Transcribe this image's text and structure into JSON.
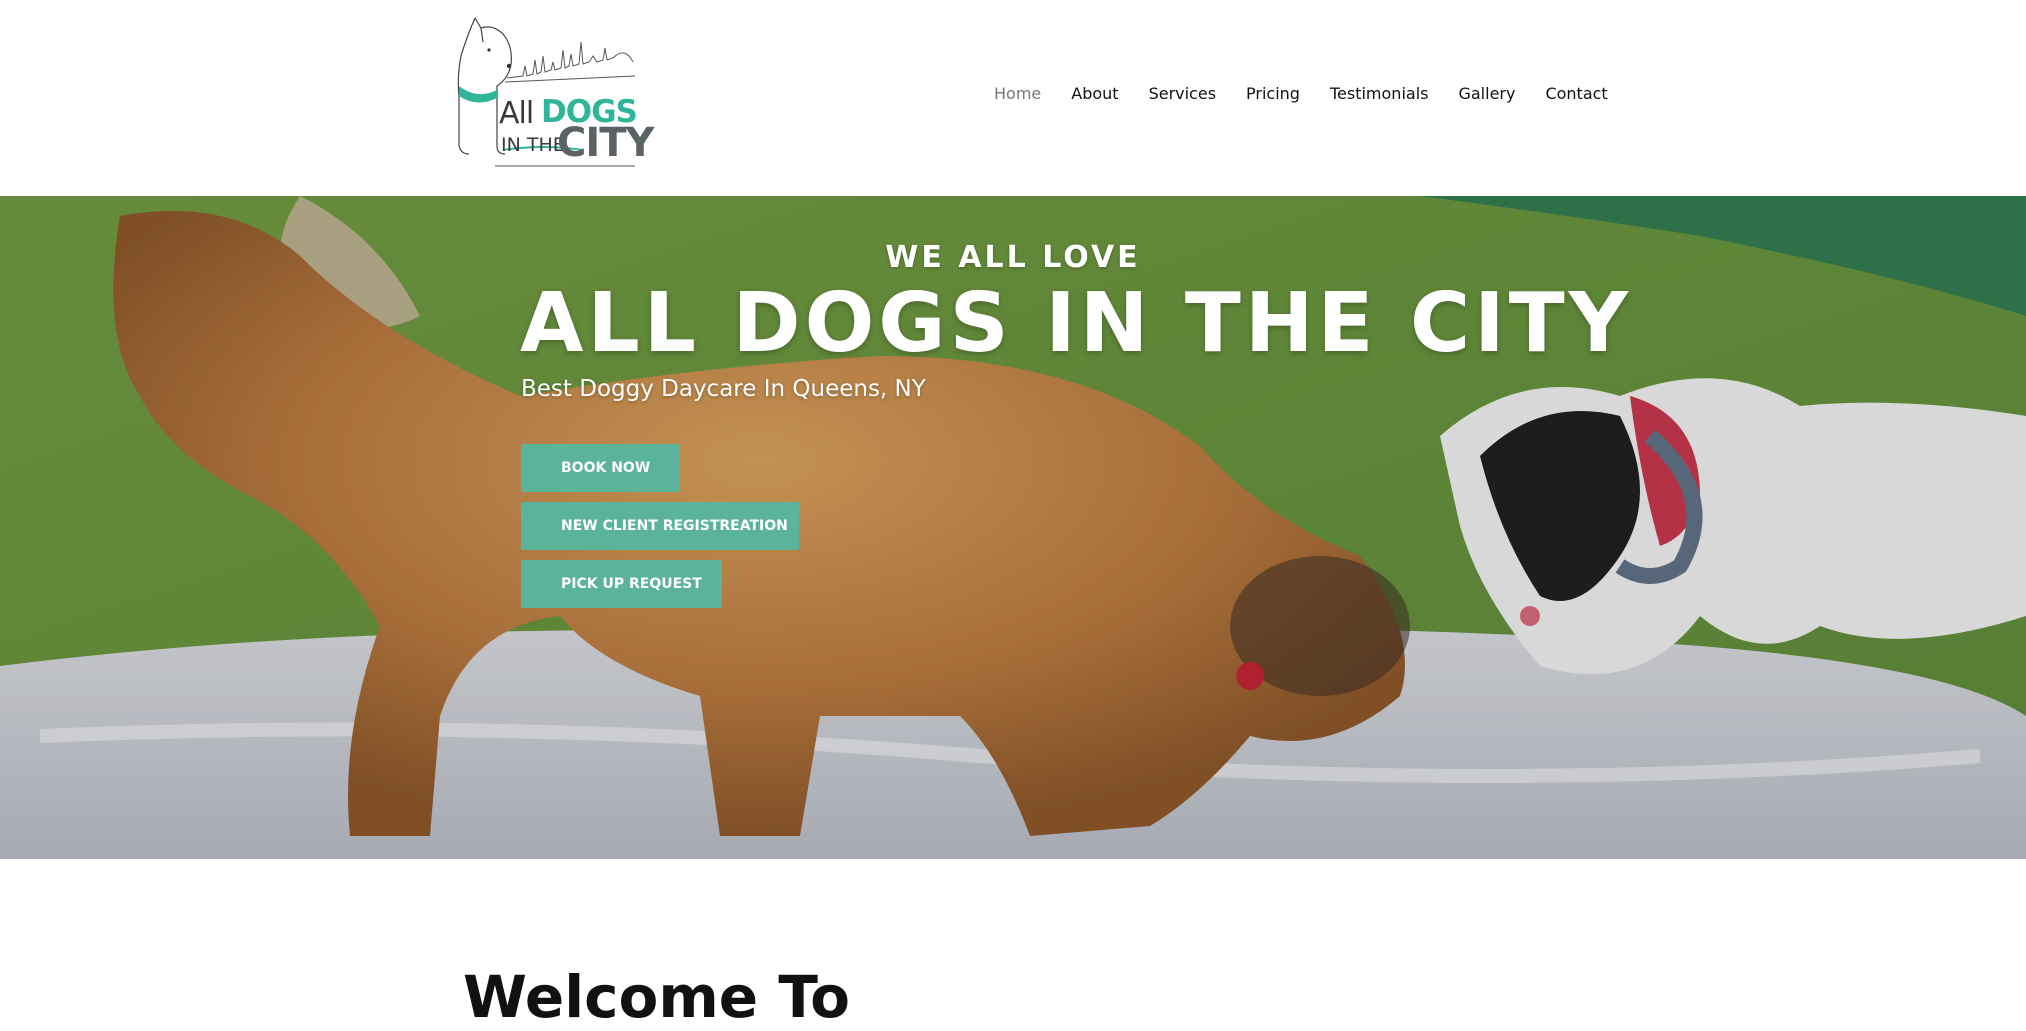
{
  "logo": {
    "word_all": "All",
    "word_dogs": "DOGS",
    "word_in_the": "IN THE",
    "word_city": "CITY"
  },
  "nav": {
    "items": [
      {
        "label": "Home",
        "active": true
      },
      {
        "label": "About",
        "active": false
      },
      {
        "label": "Services",
        "active": false
      },
      {
        "label": "Pricing",
        "active": false
      },
      {
        "label": "Testimonials",
        "active": false
      },
      {
        "label": "Gallery",
        "active": false
      },
      {
        "label": "Contact",
        "active": false
      }
    ]
  },
  "hero": {
    "eyebrow": "WE ALL LOVE",
    "title": "ALL DOGS IN THE CITY",
    "subtitle": "Best Doggy Daycare In Queens, NY",
    "buttons": {
      "book_now": "BOOK NOW",
      "new_client": "NEW CLIENT REGISTREATION",
      "pick_up": "PICK UP REQUEST"
    }
  },
  "welcome": {
    "heading_partial": "Welcome To"
  },
  "colors": {
    "accent": "#5bb39b",
    "logo_teal": "#2fb59a",
    "nav_active": "#777777",
    "text": "#111111"
  }
}
